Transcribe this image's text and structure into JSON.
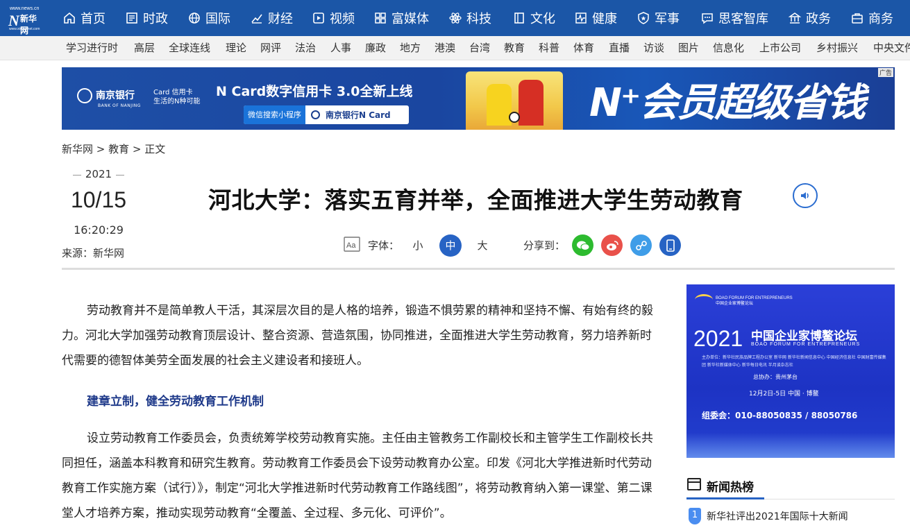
{
  "site": {
    "logo_url_text": "www.news.cn",
    "logo_mark": "NEWS",
    "logo_cn": "新华网",
    "logo_sub": "www.xinhuanet.com"
  },
  "topnav": [
    {
      "label": "首页",
      "icon": "home-icon"
    },
    {
      "label": "时政",
      "icon": "politics-icon"
    },
    {
      "label": "国际",
      "icon": "globe-icon"
    },
    {
      "label": "财经",
      "icon": "finance-chart-icon"
    },
    {
      "label": "视频",
      "icon": "video-play-icon"
    },
    {
      "label": "富媒体",
      "icon": "grid-icon"
    },
    {
      "label": "科技",
      "icon": "atom-icon"
    },
    {
      "label": "文化",
      "icon": "book-icon"
    },
    {
      "label": "健康",
      "icon": "heartbeat-icon"
    },
    {
      "label": "军事",
      "icon": "military-shield-icon"
    },
    {
      "label": "思客智库",
      "icon": "chat-icon"
    },
    {
      "label": "政务",
      "icon": "government-icon"
    },
    {
      "label": "商务",
      "icon": "briefcase-icon"
    }
  ],
  "subnav": [
    "学习进行时",
    "高层",
    "全球连线",
    "理论",
    "网评",
    "法治",
    "人事",
    "廉政",
    "地方",
    "港澳",
    "台湾",
    "教育",
    "科普",
    "体育",
    "直播",
    "访谈",
    "图片",
    "信息化",
    "上市公司",
    "乡村振兴",
    "中央文件"
  ],
  "banner": {
    "ad_tag": "广告",
    "bank_name": "南京银行",
    "bank_en": "BANK OF NANJING",
    "card_line1": "Card 信用卡",
    "card_line2": "生活的N种可能",
    "headline": "N Card数字信用卡  3.0全新上线",
    "search_label": "微信搜索小程序",
    "search_text": "南京银行N Card",
    "slogan": "N⁺会员超级省钱"
  },
  "breadcrumb": "新华网 > 教育 > 正文",
  "date": {
    "year": "2021",
    "monthday": "10/15",
    "time": "16:20:29"
  },
  "source": "来源：新华网",
  "article": {
    "title": "河北大学：落实五育并举，全面推进大学生劳动教育",
    "font_label": "字体：",
    "font_sizes": [
      "小",
      "中",
      "大"
    ],
    "share_label": "分享到：",
    "paragraphs": [
      "劳动教育并不是简单教人干活，其深层次目的是人格的培养，锻造不惧劳累的精神和坚持不懈、有始有终的毅力。河北大学加强劳动教育顶层设计、整合资源、营造氛围，协同推进，全面推进大学生劳动教育，努力培养新时代需要的德智体美劳全面发展的社会主义建设者和接班人。",
      "设立劳动教育工作委员会，负责统筹学校劳动教育实施。主任由主管教务工作副校长和主管学生工作副校长共同担任，涵盖本科教育和研究生教育。劳动教育工作委员会下设劳动教育办公室。印发《河北大学推进新时代劳动教育工作实施方案（试行）》，制定“河北大学推进新时代劳动教育工作路线图”，将劳动教育纳入第一课堂、第二课堂人才培养方案，推动实现劳动教育“全覆盖、全过程、多元化、可评价”。"
    ],
    "subheading": "建章立制，健全劳动教育工作机制"
  },
  "sidead": {
    "forum_en": "BOAO FORUM FOR ENTREPRENEURS",
    "forum_cn_small": "中国企业家博鳌论坛",
    "year": "2021",
    "name_cn": "中国企业家博鳌论坛",
    "name_en": "BOAO FORUM FOR ENTREPRENEURS",
    "host": "主办单位：新华社民族品牌工程办公室  新华网  新华社新闻信息中心  中国经济信息社  中国财富传媒集团  新华社新媒体中心  新华每日电讯  半月谈杂志社",
    "assist": "总协办：贵州茅台",
    "date_place": "12月2日-5日  中国 · 博鳌",
    "org": "组委会：010-88050835 / 88050786"
  },
  "hotnews": {
    "title": "新闻热榜",
    "items": [
      {
        "rank": "1",
        "text": "新华社评出2021年国际十大新闻"
      }
    ]
  },
  "colors": {
    "nav_blue": "#1b56a7",
    "accent": "#2763c4",
    "subhead": "#1f3a8a"
  }
}
